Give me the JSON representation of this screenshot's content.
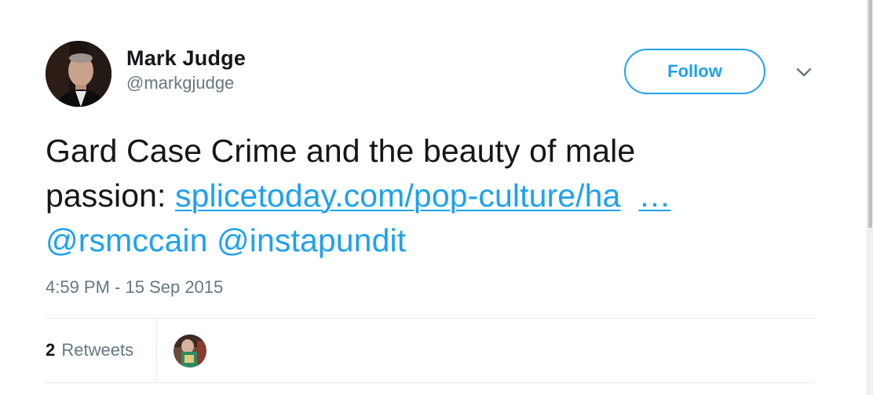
{
  "author": {
    "display_name": "Mark Judge",
    "handle": "@markgjudge",
    "avatar_icon": "user-avatar-photo"
  },
  "header": {
    "follow_label": "Follow",
    "menu_icon": "chevron-down-icon"
  },
  "tweet": {
    "text_line1": "Gard Case Crime and the beauty of male",
    "text_prefix": "passion: ",
    "link_text": "splicetoday.com/pop-culture/ha",
    "ellipsis": "…",
    "mention1": "@rsmccain",
    "mention2": "@instapundit"
  },
  "timestamp": "4:59 PM - 15 Sep 2015",
  "stats": {
    "retweet_count": "2",
    "retweet_label": "Retweets"
  },
  "colors": {
    "accent": "#1da1f2",
    "text": "#14171a",
    "muted": "#657786",
    "divider": "#e6ecf0"
  }
}
